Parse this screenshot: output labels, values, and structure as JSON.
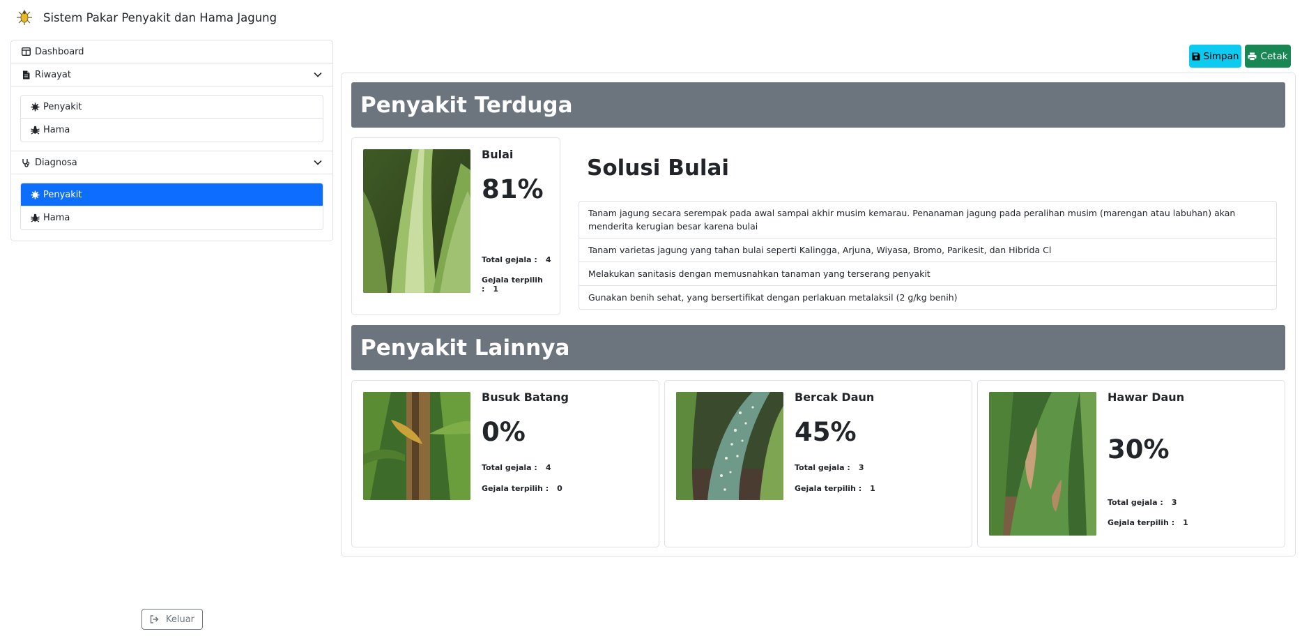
{
  "app": {
    "title": "Sistem Pakar Penyakit dan Hama Jagung",
    "logo_icon": "corn-bug-logo"
  },
  "sidebar": {
    "dashboard": "Dashboard",
    "riwayat": {
      "label": "Riwayat",
      "items": [
        "Penyakit",
        "Hama"
      ]
    },
    "diagnosa": {
      "label": "Diagnosa",
      "items": [
        "Penyakit",
        "Hama"
      ],
      "active_index": 0
    },
    "logout_label": "Keluar"
  },
  "toolbar": {
    "save_label": "Simpan",
    "print_label": "Cetak"
  },
  "colors": {
    "primary": "#0d6efd",
    "info": "#0dcaf0",
    "success": "#198754",
    "secondary": "#6c757d"
  },
  "labels": {
    "total_gejala": "Total gejala :",
    "gejala_terpilih": "Gejala terpilih :"
  },
  "suspected": {
    "section_title": "Penyakit Terduga",
    "name": "Bulai",
    "percent": "81%",
    "total_gejala": "4",
    "gejala_terpilih": "1",
    "solution_title": "Solusi Bulai",
    "solutions": [
      "Tanam jagung secara serempak pada awal sampai akhir musim kemarau. Penanaman jagung pada peralihan musim (marengan atau labuhan) akan menderita kerugian besar karena bulai",
      "Tanam varietas jagung yang tahan bulai seperti Kalingga, Arjuna, Wiyasa, Bromo, Parikesit, dan Hibrida Cl",
      "Melakukan sanitasis dengan memusnahkan tanaman yang terserang penyakit",
      "Gunakan benih sehat, yang bersertifikat dengan perlakuan metalaksil (2 g/kg benih)"
    ]
  },
  "others": {
    "section_title": "Penyakit Lainnya",
    "items": [
      {
        "name": "Busuk Batang",
        "percent": "0%",
        "total_gejala": "4",
        "gejala_terpilih": "0"
      },
      {
        "name": "Bercak Daun",
        "percent": "45%",
        "total_gejala": "3",
        "gejala_terpilih": "1"
      },
      {
        "name": "Hawar Daun",
        "percent": "30%",
        "total_gejala": "3",
        "gejala_terpilih": "1"
      }
    ]
  }
}
